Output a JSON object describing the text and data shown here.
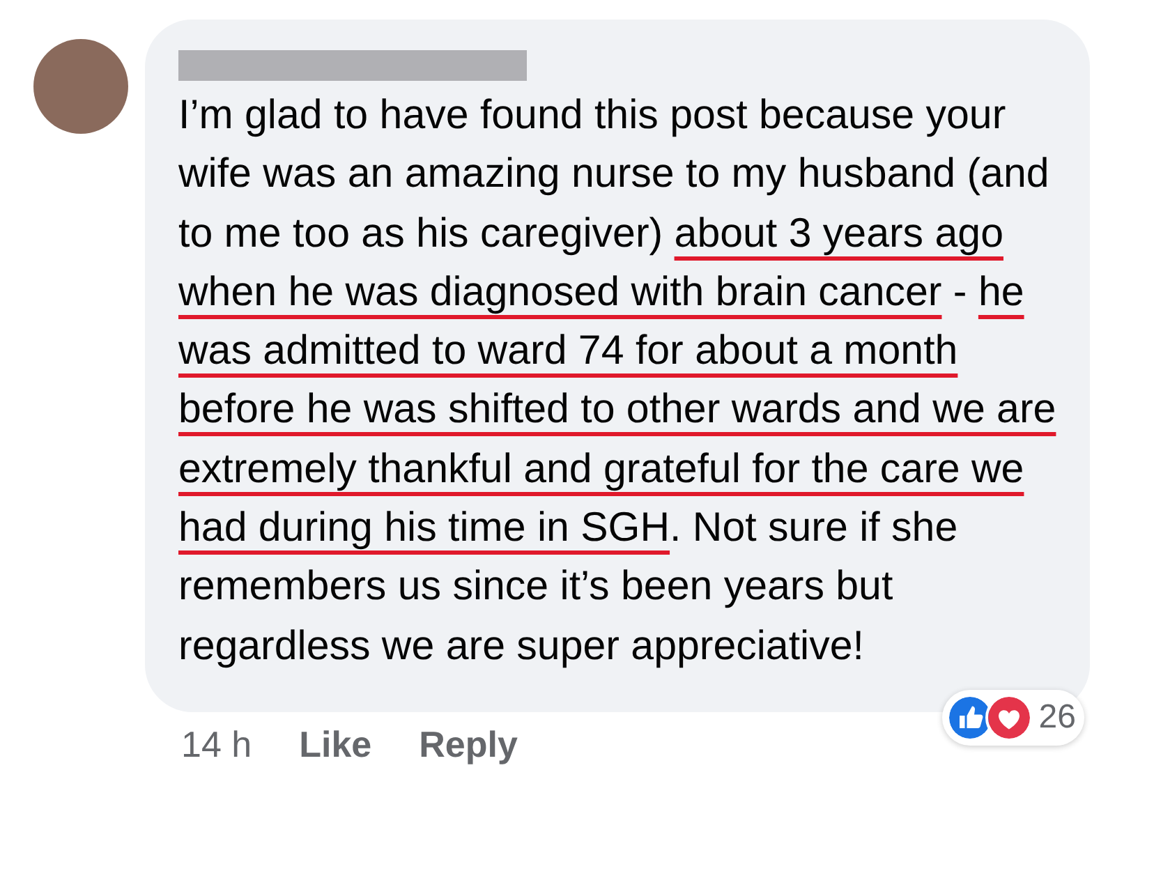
{
  "comment": {
    "body": [
      {
        "kind": "plain",
        "text": "I’m glad to have found this post because your wife was an amazing nurse to my husband (and to me too as his caregiver) "
      },
      {
        "kind": "underlined",
        "text": "about 3 years ago when he was diagnosed with brain cancer"
      },
      {
        "kind": "plain",
        "text": " - "
      },
      {
        "kind": "underlined",
        "text": "he was admitted to ward 74 for about a month before he was shifted to other wards and we are extremely thankful and grateful for the care we had during his time in SGH"
      },
      {
        "kind": "plain",
        "text": ". Not sure if she remembers us since it’s been years but regardless we are super appreciative!"
      }
    ],
    "time": "14 h",
    "actions": [
      "Like",
      "Reply"
    ],
    "reaction_count": "26"
  }
}
